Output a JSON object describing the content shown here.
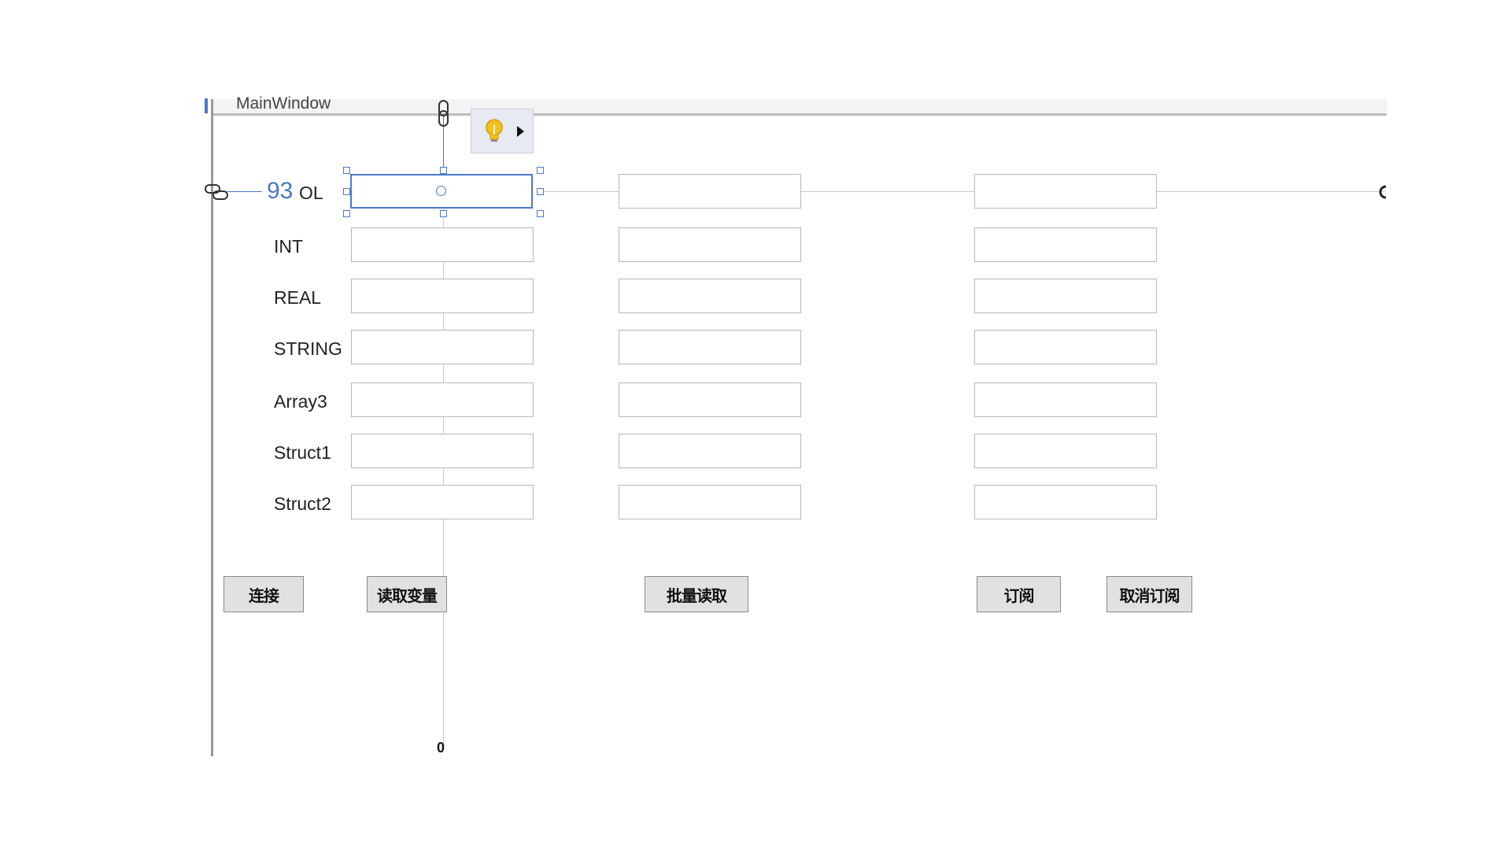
{
  "window": {
    "title": "MainWindow"
  },
  "designer": {
    "margin_value": "93",
    "rows": [
      {
        "label": "OL"
      },
      {
        "label": "INT"
      },
      {
        "label": "REAL"
      },
      {
        "label": "STRING"
      },
      {
        "label": "Array3"
      },
      {
        "label": "Struct1"
      },
      {
        "label": "Struct2"
      }
    ],
    "bottom_margin_value": "0",
    "selected_row_index": 0
  },
  "buttons": {
    "connect": "连接",
    "read_variable": "读取变量",
    "batch_read": "批量读取",
    "subscribe": "订阅",
    "unsubscribe": "取消订阅"
  },
  "colors": {
    "selection_accent": "#4a78c9",
    "bulb": "#f2c21b"
  },
  "icons": {
    "smart_tag": "light-bulb-icon",
    "smart_tag_arrow": "triangle-right-icon",
    "anchor_top": "link-chain-icon",
    "anchor_left": "link-chain-icon"
  }
}
